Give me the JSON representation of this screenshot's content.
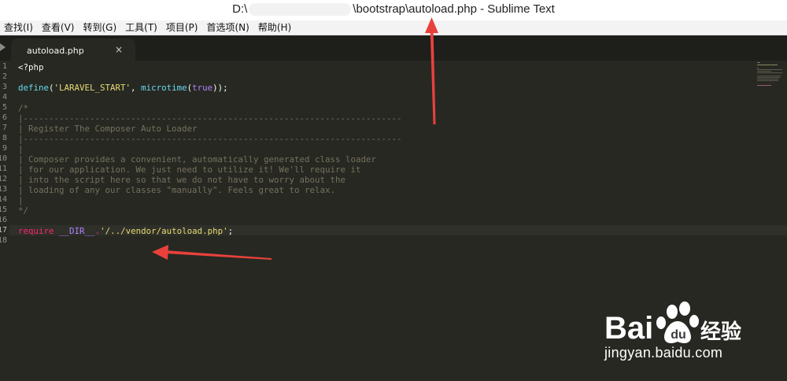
{
  "window": {
    "title_prefix": "D:\\",
    "title_suffix": "\\bootstrap\\autoload.php - Sublime Text"
  },
  "menu": [
    "查找(I)",
    "查看(V)",
    "转到(G)",
    "工具(T)",
    "项目(P)",
    "首选项(N)",
    "帮助(H)"
  ],
  "tabs": [
    {
      "label": "autoload.php",
      "close": "×"
    }
  ],
  "line_numbers": [
    "1",
    "2",
    "3",
    "4",
    "5",
    "6",
    "7",
    "8",
    "9",
    "10",
    "11",
    "12",
    "13",
    "14",
    "15",
    "16",
    "17",
    "18"
  ],
  "code": {
    "l1": "<?php",
    "l3_define": "define",
    "l3_open": "(",
    "l3_str": "'LARAVEL_START'",
    "l3_comma": ", ",
    "l3_fn": "microtime",
    "l3_open2": "(",
    "l3_true": "true",
    "l3_close": "));",
    "l5": "/*",
    "l6": "|--------------------------------------------------------------------------",
    "l7": "| Register The Composer Auto Loader",
    "l8": "|--------------------------------------------------------------------------",
    "l9": "|",
    "l10": "| Composer provides a convenient, automatically generated class loader",
    "l11": "| for our application. We just need to utilize it! We'll require it",
    "l12": "| into the script here so that we do not have to worry about the",
    "l13": "| loading of any our classes \"manually\". Feels great to relax.",
    "l14": "|",
    "l15": "*/",
    "l17_kw": "require",
    "l17_dir": "__DIR__",
    "l17_dot": ".",
    "l17_str": "'/../vendor/autoload.php'",
    "l17_end": ";"
  },
  "watermark": {
    "brand": "Bai",
    "brand_suffix": "经验",
    "url": "jingyan.baidu.com"
  },
  "colors": {
    "editor_bg": "#272822",
    "comment": "#75715e",
    "keyword": "#f92672",
    "string": "#e6db74",
    "function": "#66d9ef",
    "constant": "#ae81ff",
    "annotation_arrow": "#e8413c"
  }
}
